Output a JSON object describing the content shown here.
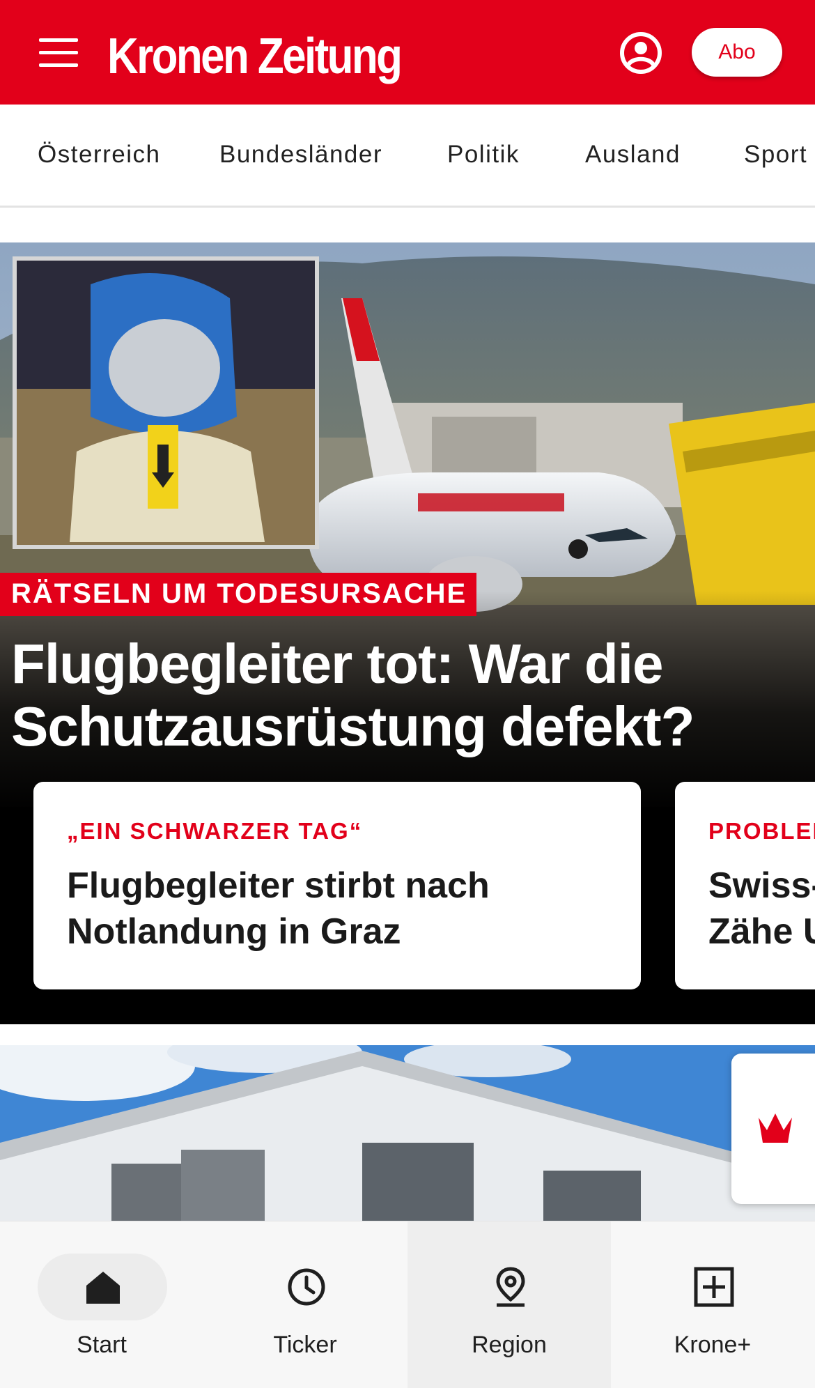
{
  "header": {
    "menu_icon": "hamburger-icon",
    "logo_text": "Kronen Zeitung",
    "account_icon": "user-circle-icon",
    "abo_label": "Abo",
    "brand_color": "#e2001a"
  },
  "categories": [
    "Österreich",
    "Bundesländer",
    "Politik",
    "Ausland",
    "Sport"
  ],
  "hero": {
    "kicker": "RÄTSELN UM TODESURSACHE",
    "title": "Flugbegleiter tot: War die Schutzausrüstung defekt?",
    "image": "photo of airplane with inset of protective hood"
  },
  "related_cards": [
    {
      "kicker": "„EIN SCHWARZER TAG“",
      "title_line1": "Flugbegleiter stirbt nach",
      "title_line2": "Notlandung in Graz"
    },
    {
      "kicker": "PROBLEI",
      "title_line1": "Swiss-",
      "title_line2": "Zähe U"
    }
  ],
  "second_article": {
    "image": "photo of building under blue sky"
  },
  "krone_fab": {
    "icon": "crown-icon"
  },
  "bottom_nav": [
    {
      "label": "Start",
      "icon": "home-icon",
      "selected": true
    },
    {
      "label": "Ticker",
      "icon": "clock-icon",
      "selected": false
    },
    {
      "label": "Region",
      "icon": "location-pin-icon",
      "selected": false
    },
    {
      "label": "Krone+",
      "icon": "plus-box-icon",
      "selected": false
    }
  ]
}
